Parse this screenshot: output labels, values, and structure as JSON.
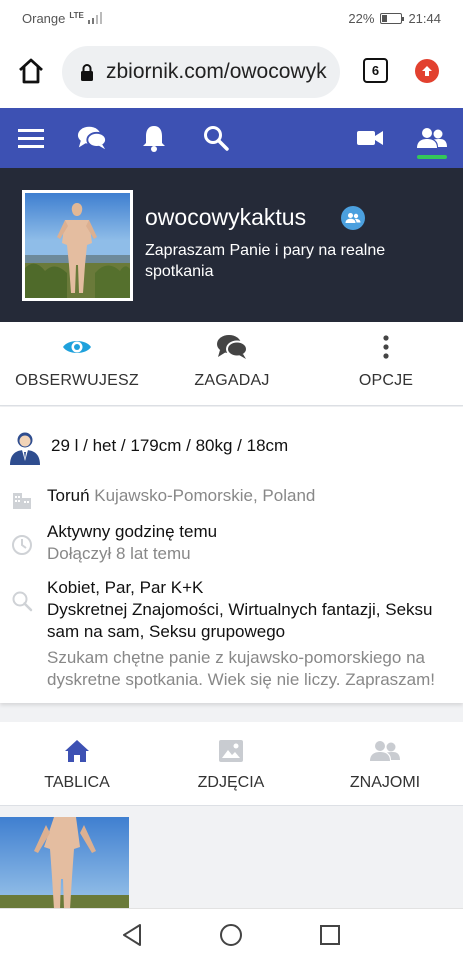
{
  "status_bar": {
    "carrier": "Orange",
    "network": "LTE",
    "battery": "22%",
    "time": "21:44"
  },
  "browser": {
    "url": "zbiornik.com/owocowyk",
    "tab_count": "6"
  },
  "navbar": {
    "icons": [
      "menu-icon",
      "chat-icon",
      "bell-icon",
      "search-icon",
      "video-icon",
      "friends-icon"
    ],
    "active_color": "#34c759",
    "bg_color": "#3d51b3"
  },
  "profile": {
    "username": "owocowykaktus",
    "tagline": "Zapraszam Panie i pary na realne spotkania"
  },
  "actions": [
    {
      "label": "OBSERWUJESZ",
      "icon": "eye-icon"
    },
    {
      "label": "ZAGADAJ",
      "icon": "chat-icon"
    },
    {
      "label": "OPCJE",
      "icon": "more-vert-icon"
    }
  ],
  "info": {
    "stats": "29 l / het / 179cm / 80kg / 18cm",
    "city": "Toruń",
    "region": "Kujawsko-Pomorskie, Poland",
    "active": "Aktywny godzinę temu",
    "joined": "Dołączył 8 lat temu",
    "looking_for": "Kobiet, Par, Par K+K",
    "interests": "Dyskretnej Znajomości, Wirtualnych fantazji, Seksu sam na sam, Seksu grupowego",
    "description": "Szukam chętne panie z kujawsko-pomorskiego na dyskretne spotkania. Wiek się nie liczy. Zapraszam!"
  },
  "bottom_tabs": [
    {
      "label": "TABLICA",
      "icon": "home-icon"
    },
    {
      "label": "ZDJĘCIA",
      "icon": "image-icon"
    },
    {
      "label": "ZNAJOMI",
      "icon": "friends-icon"
    }
  ]
}
